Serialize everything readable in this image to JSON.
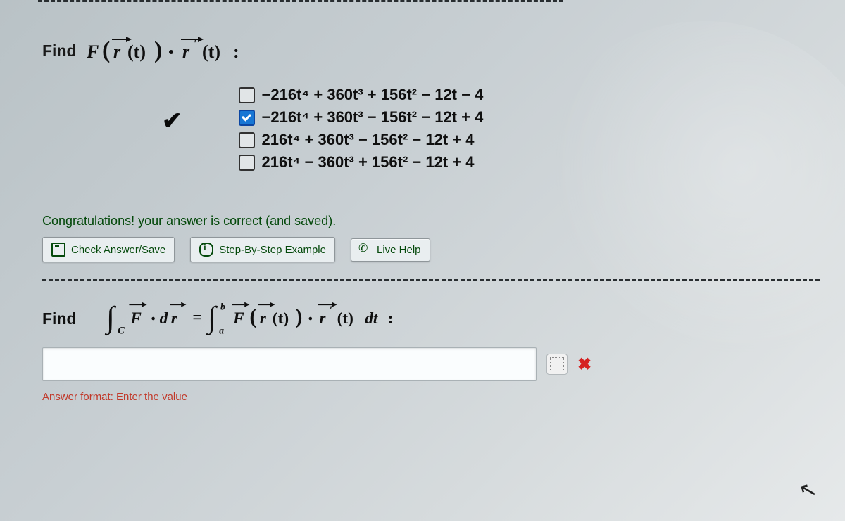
{
  "q1": {
    "prompt_lead": "Find",
    "prompt_math_alt": "F ( r(t) ) · r'(t) :",
    "correct_index": 1,
    "options": [
      "−216t⁴ + 360t³ + 156t² − 12t − 4",
      "−216t⁴ + 360t³ − 156t² − 12t + 4",
      "216t⁴ + 360t³ − 156t² − 12t + 4",
      "216t⁴ − 360t³ + 156t² − 12t + 4"
    ]
  },
  "feedback": {
    "congrats": "Congratulations! your answer is correct (and saved)."
  },
  "buttons": {
    "check_save": "Check Answer/Save",
    "step_example": "Step-By-Step Example",
    "live_help": "Live Help"
  },
  "q2": {
    "prompt_lead": "Find",
    "prompt_math_alt": "∫_C F · d r  =  ∫_a^b  F( r(t) ) · r'(t) dt :",
    "answer_value": "",
    "answer_status": "incorrect",
    "format_hint": "Answer format: Enter the value"
  },
  "icons": {
    "save": "save-icon",
    "info": "info-icon",
    "phone": "phone-icon",
    "keypad": "keypad-icon",
    "clear_x": "clear-x-icon",
    "checkmark": "checkmark-icon",
    "cursor": "cursor-icon"
  },
  "colors": {
    "hint_red": "#c0392b",
    "ok_green": "#064a0d",
    "checkbox_blue": "#1976d2"
  }
}
